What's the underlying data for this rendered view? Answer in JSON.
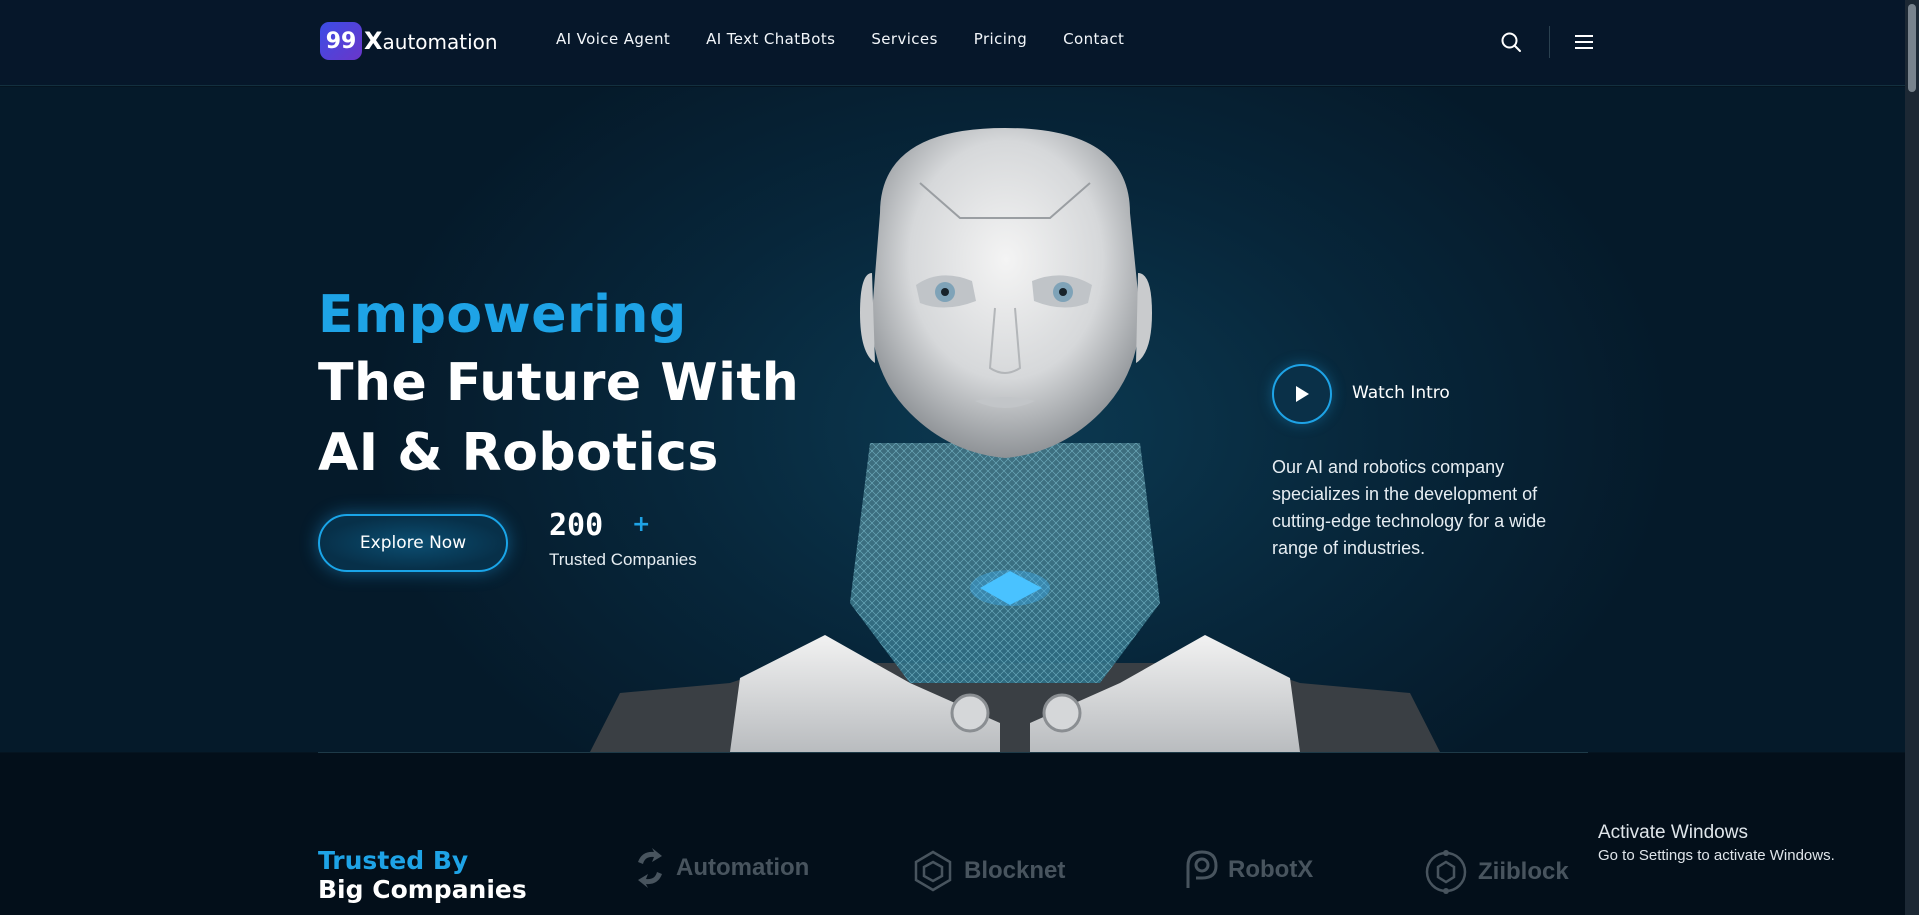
{
  "header": {
    "logo_badge": "99",
    "logo_x": "X",
    "logo_text": "automation",
    "nav": [
      {
        "label": "AI Voice Agent"
      },
      {
        "label": "AI Text ChatBots"
      },
      {
        "label": "Services"
      },
      {
        "label": "Pricing"
      },
      {
        "label": "Contact"
      }
    ],
    "icons": [
      "search-icon",
      "hamburger-menu-icon"
    ]
  },
  "hero": {
    "line1": "Empowering",
    "line2": "The Future With",
    "line3": "AI & Robotics",
    "cta_label": "Explore Now",
    "stat_value": "200",
    "stat_plus": "+",
    "stat_label": "Trusted Companies",
    "watch_label": "Watch Intro",
    "description": "Our AI and robotics company specializes in the development of cutting-edge technology for a wide range of industries."
  },
  "trusted": {
    "title_line1": "Trusted By",
    "title_line2": "Big Companies",
    "brands": [
      {
        "name": "Automation",
        "icon": "automation-logo-icon"
      },
      {
        "name": "Blocknet",
        "icon": "blocknet-logo-icon"
      },
      {
        "name": "RobotX",
        "icon": "robotx-logo-icon"
      },
      {
        "name": "Ziiblock",
        "icon": "ziiblock-logo-icon"
      }
    ]
  },
  "os_overlay": {
    "title": "Activate Windows",
    "subtitle": "Go to Settings to activate Windows."
  },
  "colors": {
    "accent": "#1ea3e6",
    "background": "#051420",
    "text": "#ffffff"
  }
}
